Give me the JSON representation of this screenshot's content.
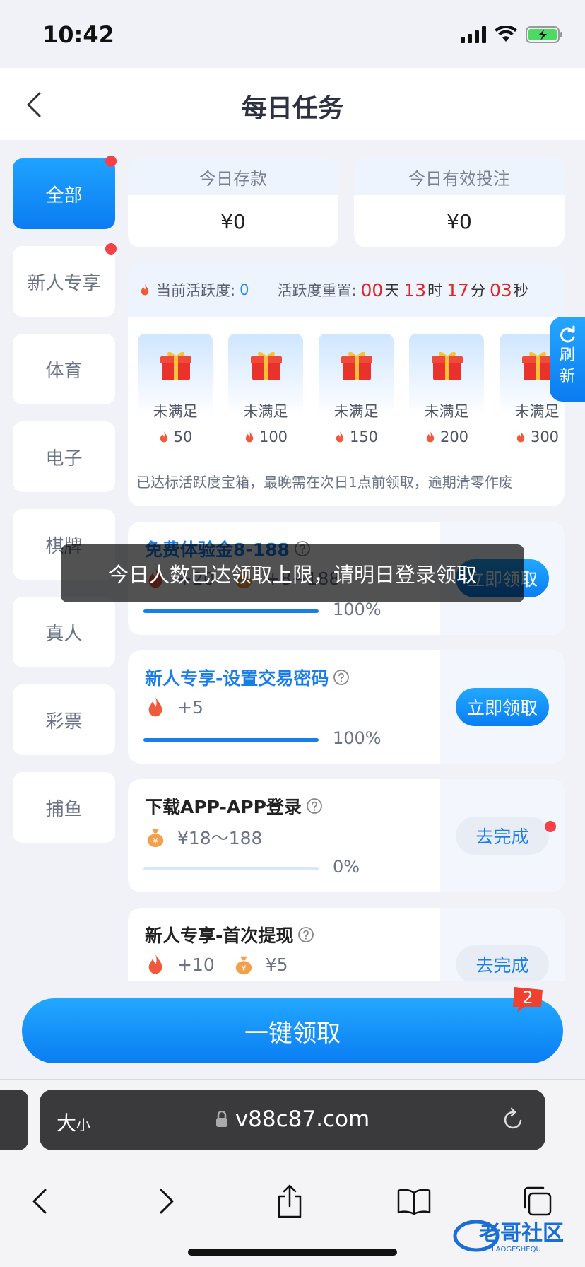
{
  "status_bar": {
    "time": "10:42"
  },
  "header": {
    "title": "每日任务"
  },
  "sidebar": {
    "items": [
      {
        "label": "全部",
        "active": true,
        "dot": true
      },
      {
        "label": "新人专享",
        "active": false,
        "dot": true
      },
      {
        "label": "体育",
        "active": false,
        "dot": false
      },
      {
        "label": "电子",
        "active": false,
        "dot": false
      },
      {
        "label": "棋牌",
        "active": false,
        "dot": false
      },
      {
        "label": "真人",
        "active": false,
        "dot": false
      },
      {
        "label": "彩票",
        "active": false,
        "dot": false
      },
      {
        "label": "捕鱼",
        "active": false,
        "dot": false
      }
    ]
  },
  "stats": {
    "deposit_label": "今日存款",
    "deposit_value": "¥0",
    "bet_label": "今日有效投注",
    "bet_value": "¥0"
  },
  "activity": {
    "current_label": "当前活跃度:",
    "current_value": "0",
    "reset_label": "活跃度重置:",
    "days": "00",
    "days_unit": "天",
    "hours": "13",
    "hours_unit": "时",
    "minutes": "17",
    "minutes_unit": "分",
    "seconds": "03",
    "seconds_unit": "秒",
    "rewards": [
      {
        "status": "未满足",
        "points": "50"
      },
      {
        "status": "未满足",
        "points": "100"
      },
      {
        "status": "未满足",
        "points": "150"
      },
      {
        "status": "未满足",
        "points": "200"
      },
      {
        "status": "未满足",
        "points": "300"
      }
    ],
    "note": "已达标活跃度宝箱，最晚需在次日1点前领取，逾期清零作废"
  },
  "tasks": [
    {
      "title": "免费体验金8-188",
      "title_blue": true,
      "fire_reward": "+20",
      "money_reward": "+8~188",
      "progress": 1.0,
      "progress_text": "100%",
      "button": "立即领取",
      "button_type": "primary",
      "dot": false
    },
    {
      "title": "新人专享-设置交易密码",
      "title_blue": true,
      "fire_reward": "+5",
      "money_reward": "",
      "progress": 1.0,
      "progress_text": "100%",
      "button": "立即领取",
      "button_type": "primary",
      "dot": false
    },
    {
      "title": "下载APP-APP登录",
      "title_blue": false,
      "fire_reward": "",
      "money_reward": "¥18～188",
      "progress": 0.0,
      "progress_text": "0%",
      "button": "去完成",
      "button_type": "secondary",
      "dot": true
    },
    {
      "title": "新人专享-首次提现",
      "title_blue": false,
      "fire_reward": "+10",
      "money_reward": "¥5",
      "progress": 0.0,
      "progress_text": "",
      "button": "去完成",
      "button_type": "secondary",
      "dot": false
    }
  ],
  "refresh_tab": {
    "line1": "刷",
    "line2": "新"
  },
  "toast": {
    "message": "今日人数已达领取上限，请明日登录领取"
  },
  "claim_all": {
    "label": "一键领取",
    "badge": "2"
  },
  "browser": {
    "aa_big": "大",
    "aa_small": "小",
    "url": "v88c87.com"
  },
  "watermark": {
    "text": "老哥社区",
    "sub": "LAOGESHEQU"
  },
  "colors": {
    "accent": "#0a7cf2",
    "danger": "#f5404a",
    "countdown": "#e0262a"
  },
  "icons": [
    "back-arrow-icon",
    "fire-icon",
    "money-bag-icon",
    "gift-icon",
    "help-icon",
    "refresh-icon",
    "lock-icon",
    "reload-icon",
    "share-icon",
    "book-icon",
    "tabs-icon"
  ]
}
